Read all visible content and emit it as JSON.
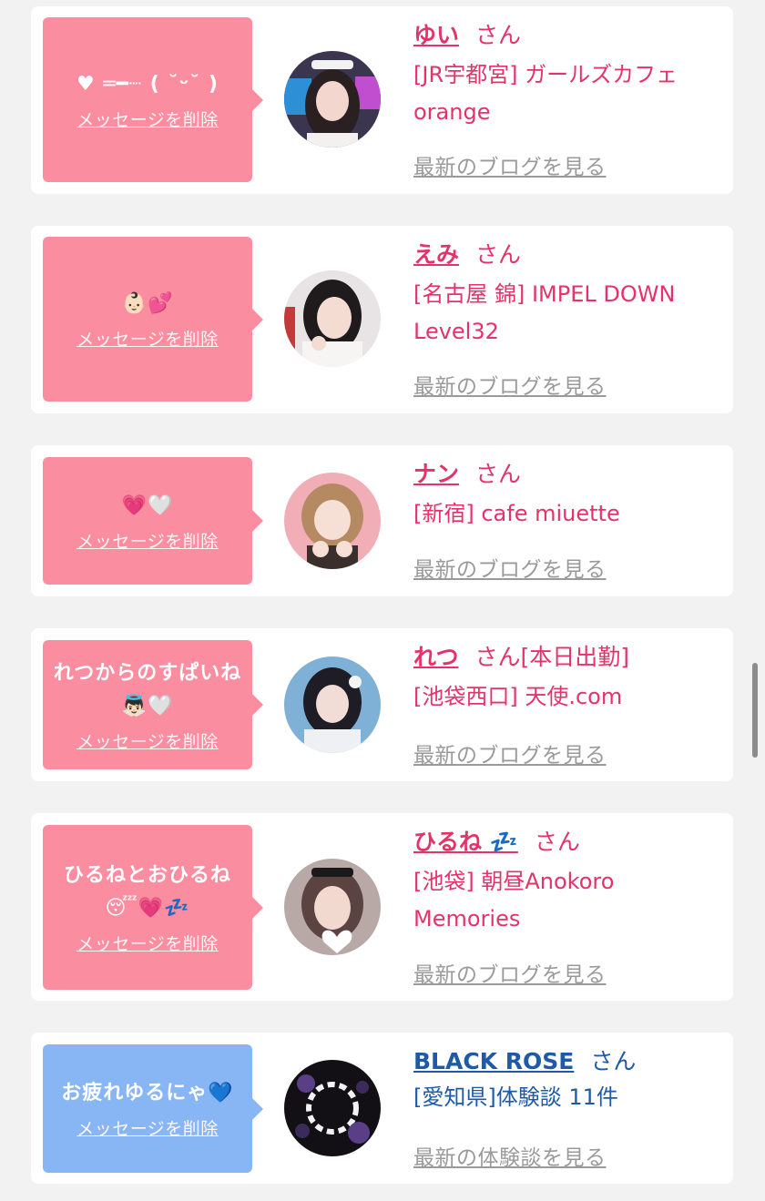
{
  "cards": [
    {
      "message": "♥ ═━┈ ( ˘ᵕ˘ )",
      "delete_label": "メッセージを削除",
      "name": "ゆい",
      "honorific": "さん",
      "extra": "",
      "shop": "[JR宇都宮] ガールズカフェorange",
      "link": "最新のブログを見る"
    },
    {
      "message": "👶🏻💕",
      "delete_label": "メッセージを削除",
      "name": "えみ",
      "honorific": "さん",
      "extra": "",
      "shop": "[名古屋 錦] IMPEL DOWN Level32",
      "link": "最新のブログを見る"
    },
    {
      "message": "💗🤍",
      "delete_label": "メッセージを削除",
      "name": "ナン",
      "honorific": "さん",
      "extra": "",
      "shop": "[新宿] cafe miuette",
      "link": "最新のブログを見る"
    },
    {
      "message": "れつからのすぱいね👼🏻🤍",
      "delete_label": "メッセージを削除",
      "name": "れつ",
      "honorific": "さん",
      "extra": "[本日出勤]",
      "shop": "[池袋西口] 天使.com",
      "link": "最新のブログを見る"
    },
    {
      "message": "ひるねとおひるね😴💗💤",
      "delete_label": "メッセージを削除",
      "name": "ひるね 💤",
      "honorific": "さん",
      "extra": "",
      "shop": "[池袋] 朝昼Anokoro Memories",
      "link": "最新のブログを見る"
    },
    {
      "message": "お疲れゆるにゃ💙",
      "delete_label": "メッセージを削除",
      "name": "BLACK ROSE",
      "honorific": "さん",
      "extra": "",
      "shop": "[愛知県]体験談 11件",
      "link": "最新の体験談を見る"
    }
  ],
  "colors": {
    "pink_bubble": "#fb8da0",
    "blue_bubble": "#88b6f5",
    "pink_text": "#e5336a",
    "blue_text": "#1f5aa8",
    "link_gray": "#9a9a9a"
  }
}
